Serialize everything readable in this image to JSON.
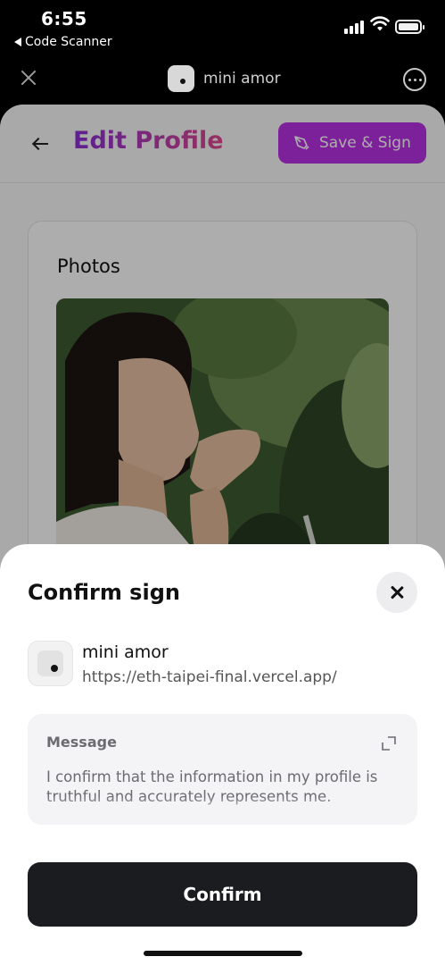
{
  "status_bar": {
    "time": "6:55",
    "back_app": "Code Scanner"
  },
  "mini_app_header": {
    "title": "mini amor"
  },
  "page": {
    "title": "Edit Profile",
    "save_button": "Save & Sign",
    "section_label": "Photos",
    "accent_color": "#b732e3"
  },
  "sheet": {
    "title": "Confirm sign",
    "app_name": "mini amor",
    "app_url": "https://eth-taipei-final.vercel.app/",
    "message_label": "Message",
    "message_text": "I confirm that the information in my profile is truthful and accurately represents me.",
    "confirm_button": "Confirm"
  },
  "icons": [
    "close-icon",
    "more-options-icon",
    "back-arrow-icon",
    "pen-sign-icon",
    "expand-icon",
    "signal-icon",
    "wifi-icon",
    "battery-icon"
  ]
}
